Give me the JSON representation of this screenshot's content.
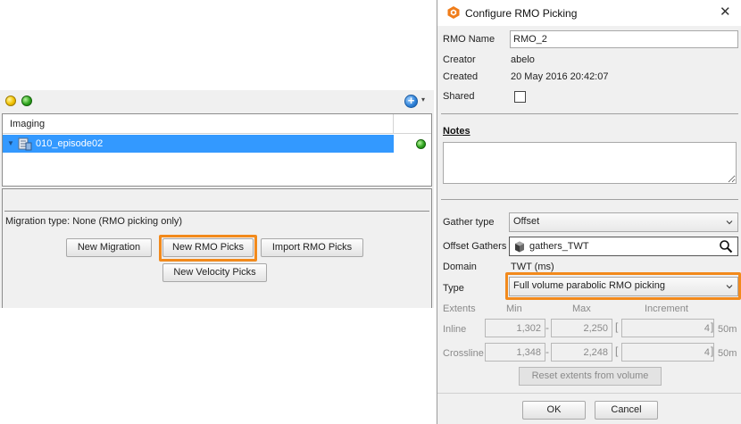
{
  "left_panel": {
    "tree_header": "Imaging",
    "tree_item": "010_episode02",
    "migration_type": "Migration type: None (RMO picking only)",
    "buttons": {
      "new_migration": "New Migration",
      "new_rmo_picks": "New RMO Picks",
      "import_rmo_picks": "Import RMO Picks",
      "new_velocity_picks": "New Velocity Picks"
    },
    "add_icon_glyph": "+",
    "add_arrow_glyph": "▾",
    "expand_glyph": "▼"
  },
  "dialog": {
    "title": "Configure RMO Picking",
    "close_glyph": "✕",
    "rmo_name_label": "RMO Name",
    "rmo_name_value": "RMO_2",
    "creator_label": "Creator",
    "creator_value": "abelo",
    "created_label": "Created",
    "created_value": "20 May 2016 20:42:07",
    "shared_label": "Shared",
    "notes_title": "Notes",
    "gather_type_label": "Gather type",
    "gather_type_value": "Offset",
    "offset_gathers_label": "Offset Gathers",
    "offset_gathers_value": "gathers_TWT",
    "domain_label": "Domain",
    "domain_value": "TWT (ms)",
    "type_label": "Type",
    "type_value": "Full volume parabolic RMO picking",
    "extents": {
      "label": "Extents",
      "min_label": "Min",
      "max_label": "Max",
      "increment_label": "Increment",
      "inline_label": "Inline",
      "inline_min": "1,302",
      "inline_max": "2,250",
      "inline_inc": "4",
      "inline_unit": "50m",
      "crossline_label": "Crossline",
      "crossline_min": "1,348",
      "crossline_max": "2,248",
      "crossline_inc": "4",
      "crossline_unit": "50m",
      "dash": "-",
      "open_bracket": "[",
      "close_bracket": "]"
    },
    "reset_button": "Reset extents from volume",
    "ok_button": "OK",
    "cancel_button": "Cancel"
  },
  "colors": {
    "selection": "#3399ff",
    "highlight": "#f28a1c"
  }
}
